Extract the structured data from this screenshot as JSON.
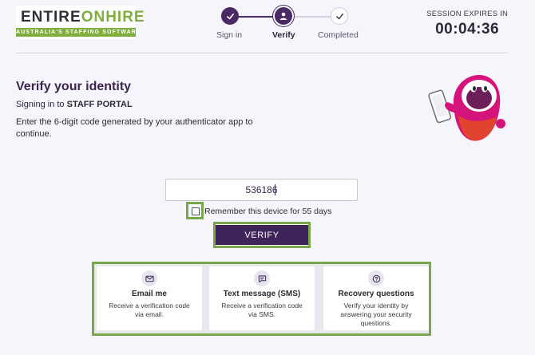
{
  "header": {
    "logo": {
      "primary": "ENTIRE",
      "accent": "ONHIRE",
      "tagline": "AUSTRALIA'S STAFFING SOFTWARE"
    },
    "steps": [
      {
        "label": "Sign in",
        "state": "done"
      },
      {
        "label": "Verify",
        "state": "active"
      },
      {
        "label": "Completed",
        "state": "todo"
      }
    ],
    "session": {
      "label": "SESSION EXPIRES IN",
      "timer": "00:04:36"
    }
  },
  "intro": {
    "title": "Verify your identity",
    "signing_prefix": "Signing in to ",
    "portal": "STAFF PORTAL",
    "instructions": "Enter the 6-digit code generated by your authenticator app to continue."
  },
  "form": {
    "code_value": "536186",
    "remember_label": "Remember this device for 55 days",
    "remember_checked": false,
    "verify_label": "VERIFY"
  },
  "options": [
    {
      "title": "Email me",
      "desc": "Receive a verification code via email.",
      "icon": "mail-icon"
    },
    {
      "title": "Text message (SMS)",
      "desc": "Receive a verification code via SMS.",
      "icon": "message-icon"
    },
    {
      "title": "Recovery questions",
      "desc": "Verify your identity by answering your security questions.",
      "icon": "question-icon"
    }
  ],
  "colors": {
    "brand_purple": "#3f2459",
    "highlight_green": "#78a84a",
    "mascot_magenta": "#d4147a"
  }
}
